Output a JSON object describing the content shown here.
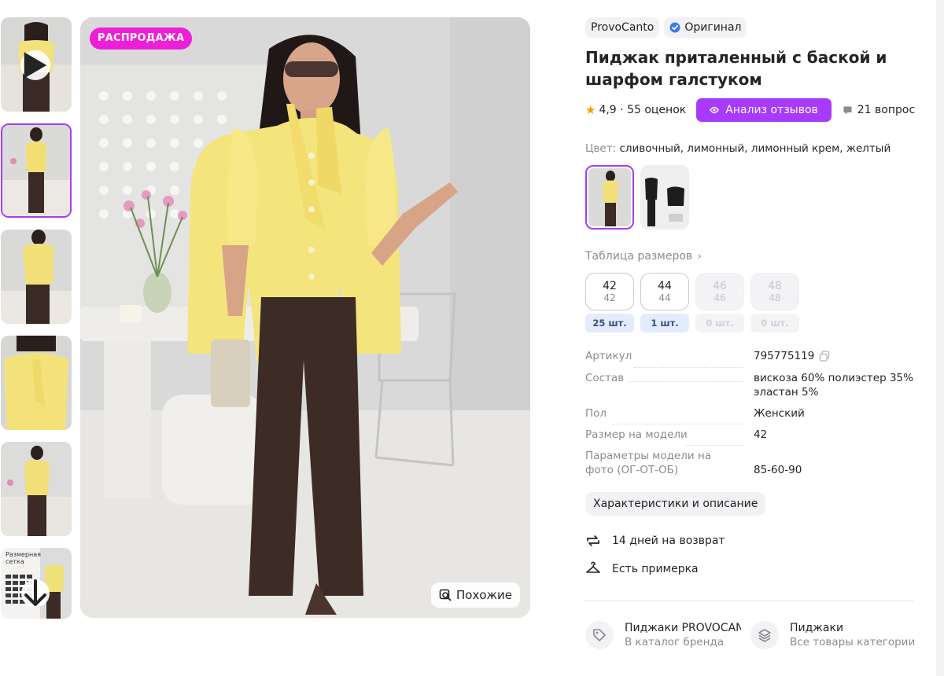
{
  "gallery": {
    "thumbnails": [
      {
        "kind": "video",
        "icon": "play-icon",
        "tone": "yellow-top-dark-trousers"
      },
      {
        "kind": "photo",
        "active": true,
        "tone": "full-body-yellow"
      },
      {
        "kind": "photo",
        "tone": "side-yellow"
      },
      {
        "kind": "photo",
        "tone": "closeup-yellow"
      },
      {
        "kind": "photo",
        "tone": "full-body-yellow"
      },
      {
        "kind": "size-chart",
        "caption": "Размерная сетка",
        "icon": "arrow-down-icon"
      }
    ],
    "sale_badge": "РАСПРОДАЖА",
    "similar_button": "Похожие",
    "similar_icon": "search-image-icon"
  },
  "product": {
    "brand": "ProvoCanto",
    "original_badge": "Оригинал",
    "original_icon": "verified-check-icon",
    "title": "Пиджак приталенный с баской и шарфом галстуком",
    "rating": "4,9 · 55 оценок",
    "analyze_button": "Анализ отзывов",
    "questions": "21 вопрос",
    "color_label": "Цвет:",
    "color_value": "сливочный, лимонный, лимонный крем, желтый",
    "size_table_link": "Таблица размеров",
    "sizes": [
      {
        "main": "42",
        "alt": "42",
        "stock": "25 шт.",
        "available": true
      },
      {
        "main": "44",
        "alt": "44",
        "stock": "1 шт.",
        "available": true
      },
      {
        "main": "46",
        "alt": "46",
        "stock": "0 шт.",
        "available": false
      },
      {
        "main": "48",
        "alt": "48",
        "stock": "0 шт.",
        "available": false
      }
    ],
    "params": [
      {
        "key": "Артикул",
        "value": "795775119"
      },
      {
        "key": "Состав",
        "value": "вискоза 60% полиэстер 35% эластан 5%"
      },
      {
        "key": "Пол",
        "value": "Женский"
      },
      {
        "key": "Размер на модели",
        "value": "42"
      },
      {
        "key": "Параметры модели на фото (ОГ-ОТ-ОБ)",
        "value": "85-60-90"
      }
    ],
    "details_button": "Характеристики и описание",
    "features": [
      {
        "icon": "return-arrows-icon",
        "text": "14 дней на возврат"
      },
      {
        "icon": "hanger-icon",
        "text": "Есть примерка"
      }
    ],
    "links": [
      {
        "icon": "tag-icon",
        "title": "Пиджаки PROVOCANTO",
        "subtitle": "В каталог бренда"
      },
      {
        "icon": "layers-icon",
        "title": "Пиджаки",
        "subtitle": "Все товары категории"
      }
    ]
  },
  "colors": {
    "accent": "#a73afd",
    "sale": "#ee1fd8",
    "rating_star": "#ff9a00",
    "stock_bg": "#e3ebfd",
    "muted_text": "#8b8b8f"
  }
}
